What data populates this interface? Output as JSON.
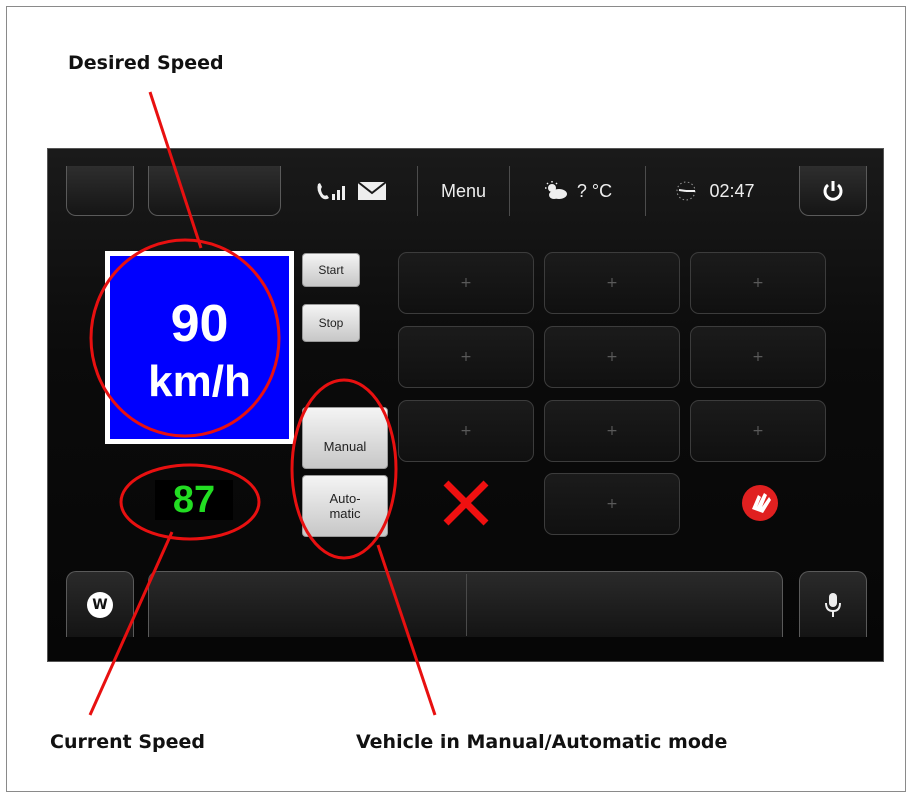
{
  "callouts": {
    "desired": "Desired Speed",
    "current": "Current Speed",
    "mode": "Vehicle in Manual/Automatic mode"
  },
  "status": {
    "menu": "Menu",
    "temperature": "? °C",
    "time": "02:47"
  },
  "sign": {
    "speed": "90",
    "unit": "km/h"
  },
  "current_speed": "87",
  "buttons": {
    "start": "Start",
    "stop": "Stop",
    "manual": "Manual",
    "auto_1": "Auto-",
    "auto_2": "matic"
  },
  "slot_symbol": "+",
  "w_button": "W",
  "colors": {
    "annotation": "#e81010",
    "sign_blue": "#0000ff",
    "current_speed": "#22dd22"
  }
}
